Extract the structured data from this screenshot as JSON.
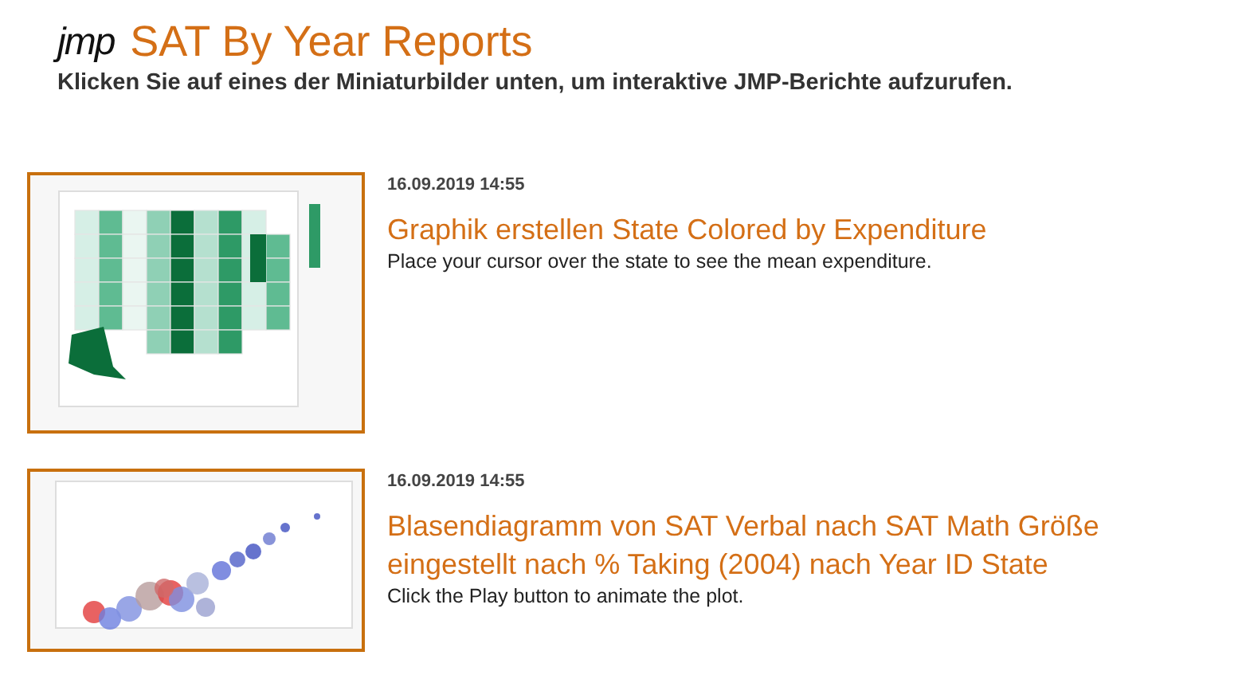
{
  "header": {
    "logo": "jmp",
    "title": "SAT By Year Reports",
    "subtitle": "Klicken Sie auf eines der Miniaturbilder unten, um interaktive JMP-Berichte aufzurufen."
  },
  "reports": [
    {
      "date": "16.09.2019 14:55",
      "title": "Graphik erstellen State Colored by Expenditure",
      "description": "Place your cursor over the state to see the mean expenditure."
    },
    {
      "date": "16.09.2019 14:55",
      "title": "Blasendiagramm von SAT Verbal nach SAT Math Größe eingestellt nach % Taking (2004) nach Year ID State",
      "description": "Click the Play button to animate the plot."
    }
  ]
}
